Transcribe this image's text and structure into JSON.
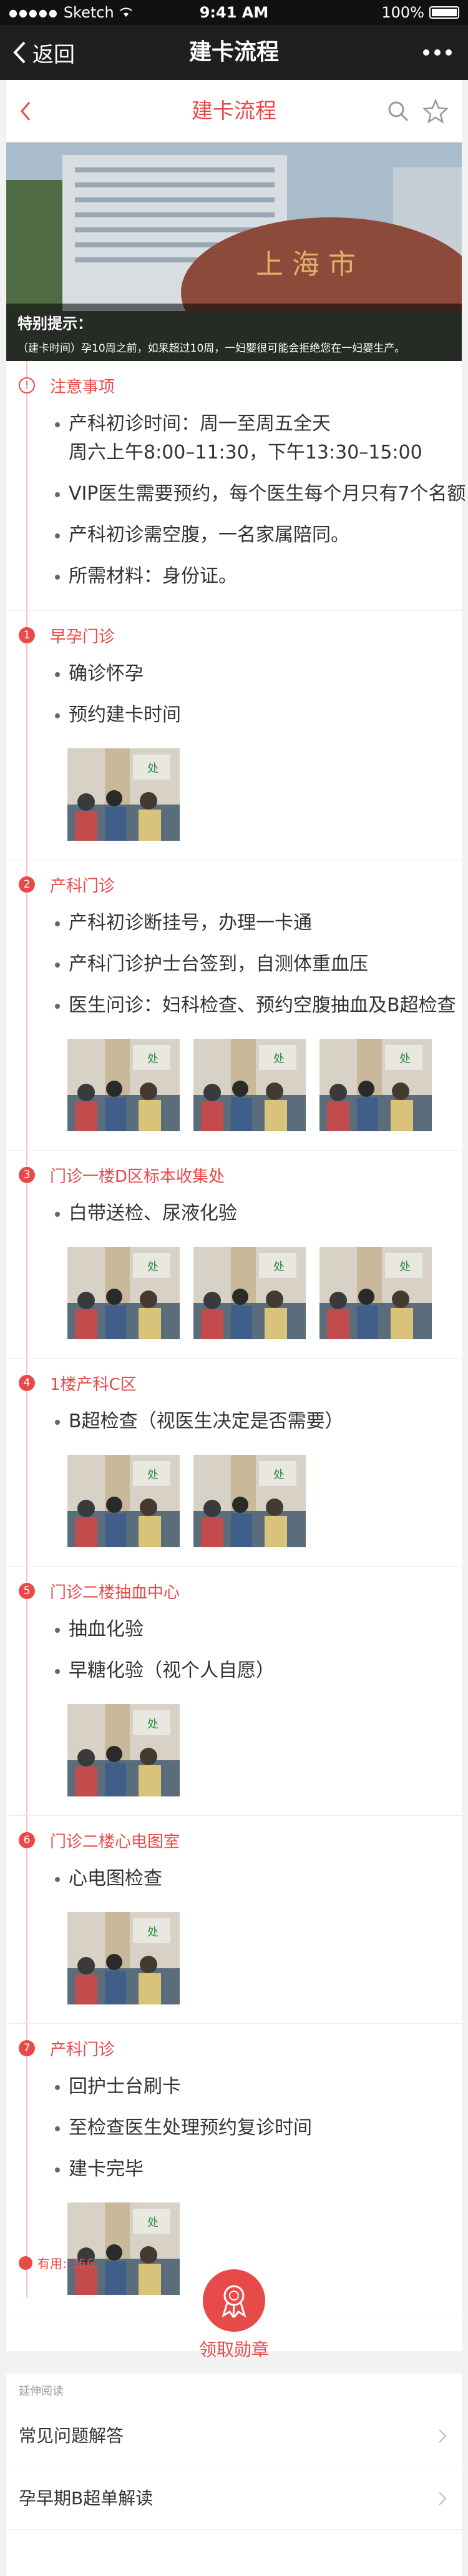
{
  "status_bar": {
    "carrier": "Sketch",
    "time": "9:41 AM",
    "battery": "100%"
  },
  "nav": {
    "back_label": "返回",
    "title": "建卡流程"
  },
  "subheader": {
    "title": "建卡流程"
  },
  "hero": {
    "tip_title": "特别提示：",
    "tip_text": "（建卡时间）孕10周之前，如果超过10周，一妇婴很可能会拒绝您在一妇婴生产。"
  },
  "notice": {
    "badge": "!",
    "title": "注意事项",
    "items": [
      {
        "line1": "产科初诊时间：周一至周五全天",
        "line2": "周六上午8:00–11:30，下午13:30–15:00"
      },
      {
        "line1": "VIP医生需要预约，每个医生每个月只有7个名额"
      },
      {
        "line1": "产科初诊需空腹，一名家属陪同。"
      },
      {
        "line1": "所需材料：身份证。"
      }
    ]
  },
  "steps": [
    {
      "num": "1",
      "title": "早孕门诊",
      "items": [
        "确诊怀孕",
        "预约建卡时间"
      ],
      "photos": [
        "处"
      ]
    },
    {
      "num": "2",
      "title": "产科门诊",
      "items": [
        "产科初诊断挂号，办理一卡通",
        "产科门诊护士台签到，自测体重血压",
        "医生问诊：妇科检查、预约空腹抽血及B超检查"
      ],
      "photos": [
        "处",
        "处",
        "处"
      ]
    },
    {
      "num": "3",
      "title": "门诊一楼D区标本收集处",
      "items": [
        "白带送检、尿液化验"
      ],
      "photos": [
        "处",
        "处",
        "处"
      ]
    },
    {
      "num": "4",
      "title": "1楼产科C区",
      "items": [
        "B超检查（视医生决定是否需要）"
      ],
      "photos": [
        "处",
        "处"
      ]
    },
    {
      "num": "5",
      "title": "门诊二楼抽血中心",
      "items": [
        "抽血化验",
        "早糖化验（视个人自愿）"
      ],
      "photos": [
        "处"
      ]
    },
    {
      "num": "6",
      "title": "门诊二楼心电图室",
      "items": [
        "心电图检查"
      ],
      "photos": [
        "处"
      ]
    },
    {
      "num": "7",
      "title": "产科门诊",
      "items": [
        "回护士台刷卡",
        "至检查医生处理预约复诊时间",
        "建卡完毕"
      ],
      "photos": [
        "处"
      ]
    }
  ],
  "footer": {
    "useful": "有用: 356",
    "medal_label": "领取勋章"
  },
  "extended": {
    "caption": "延伸阅读",
    "links": [
      "常见问题解答",
      "孕早期B超单解读"
    ]
  },
  "colors": {
    "accent": "#e84a4a",
    "nav_bg": "#1f1f1f"
  }
}
